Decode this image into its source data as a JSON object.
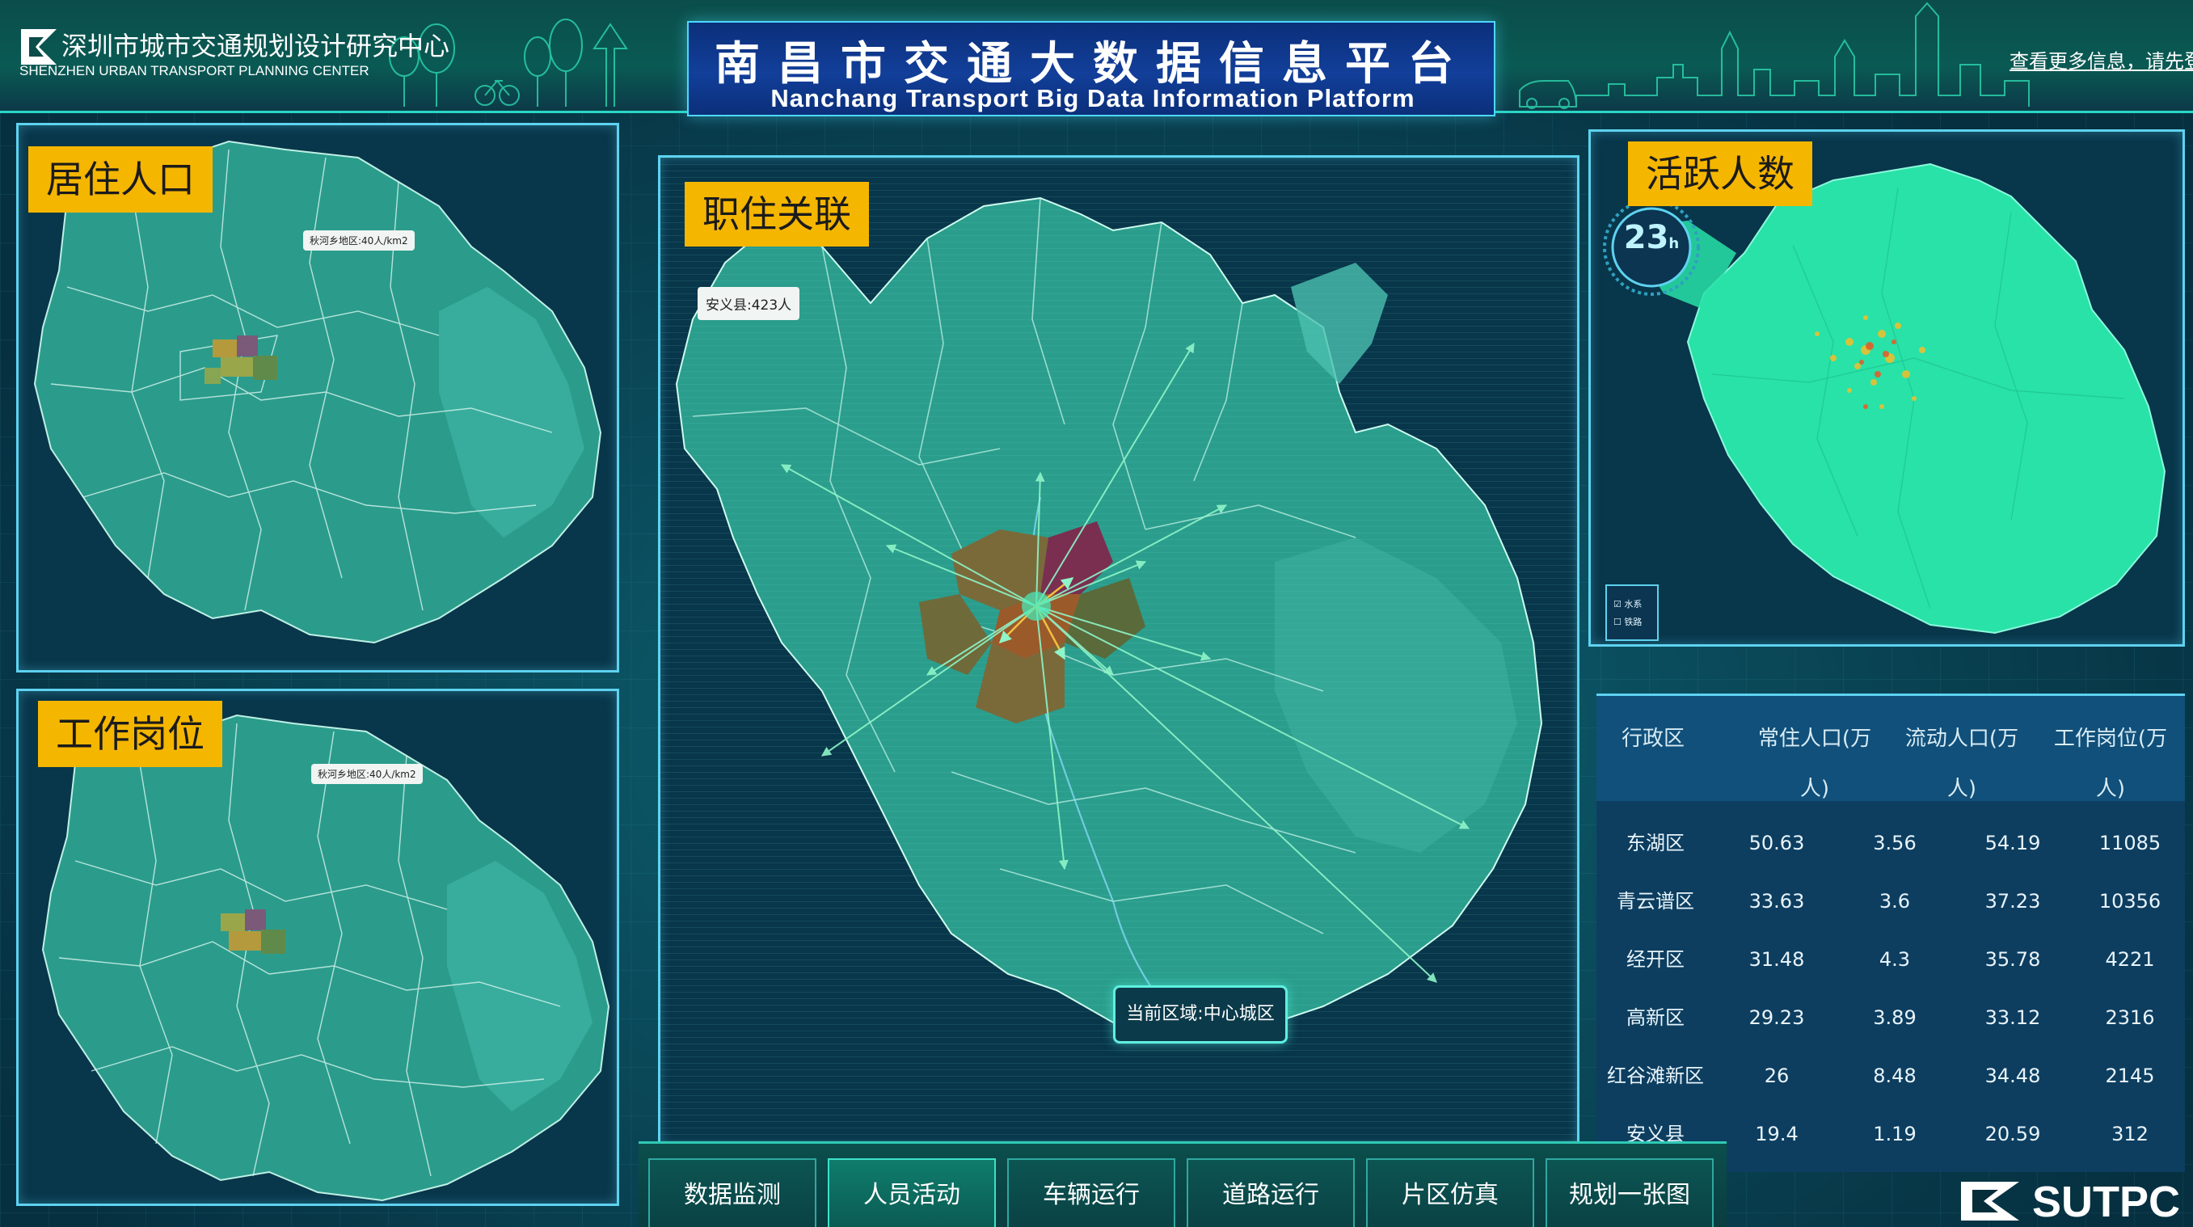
{
  "header": {
    "org_name_cn": "深圳市城市交通规划设计研究中心",
    "org_name_en": "SHENZHEN URBAN TRANSPORT PLANNING CENTER",
    "logo_text": "SUTPC.COM",
    "title_cn": "南昌市交通大数据信息平台",
    "title_en": "Nanchang Transport Big Data Information Platform",
    "login_link": "查看更多信息，请先登录"
  },
  "panels": {
    "residence": {
      "label": "居住人口",
      "tooltip": "秋河乡地区:40人/km2"
    },
    "workplace": {
      "label": "工作岗位",
      "tooltip": "秋河乡地区:40人/km2"
    },
    "commute": {
      "label": "职住关联",
      "tooltip": "安义县:423人",
      "current_area": "当前区域:中心城区"
    },
    "active": {
      "label": "活跃人数",
      "clock_value": "23",
      "clock_unit": "h",
      "legend": [
        "水系",
        "铁路"
      ]
    }
  },
  "table": {
    "headers": [
      {
        "line1": "行政区",
        "line2": ""
      },
      {
        "line1": "常住人口(万",
        "line2": "人)"
      },
      {
        "line1": "流动人口(万",
        "line2": "人)"
      },
      {
        "line1": "工作岗位(万",
        "line2": "人)"
      }
    ],
    "rows": [
      [
        "东湖区",
        "50.63",
        "3.56",
        "54.19",
        "11085"
      ],
      [
        "青云谱区",
        "33.63",
        "3.6",
        "37.23",
        "10356"
      ],
      [
        "经开区",
        "31.48",
        "4.3",
        "35.78",
        "4221"
      ],
      [
        "高新区",
        "29.23",
        "3.89",
        "33.12",
        "2316"
      ],
      [
        "红谷滩新区",
        "26",
        "8.48",
        "34.48",
        "2145"
      ],
      [
        "安义县",
        "19.4",
        "1.19",
        "20.59",
        "312"
      ]
    ]
  },
  "nav": {
    "items": [
      "数据监测",
      "人员活动",
      "车辆运行",
      "道路运行",
      "片区仿真",
      "规划一张图"
    ],
    "active": "人员活动"
  },
  "brand": "SUTPC",
  "colors": {
    "accent_yellow": "#f5b600",
    "panel_border": "#5ed2f0",
    "map_teal": "#2a9c8a",
    "active_green": "#1fd69a"
  }
}
